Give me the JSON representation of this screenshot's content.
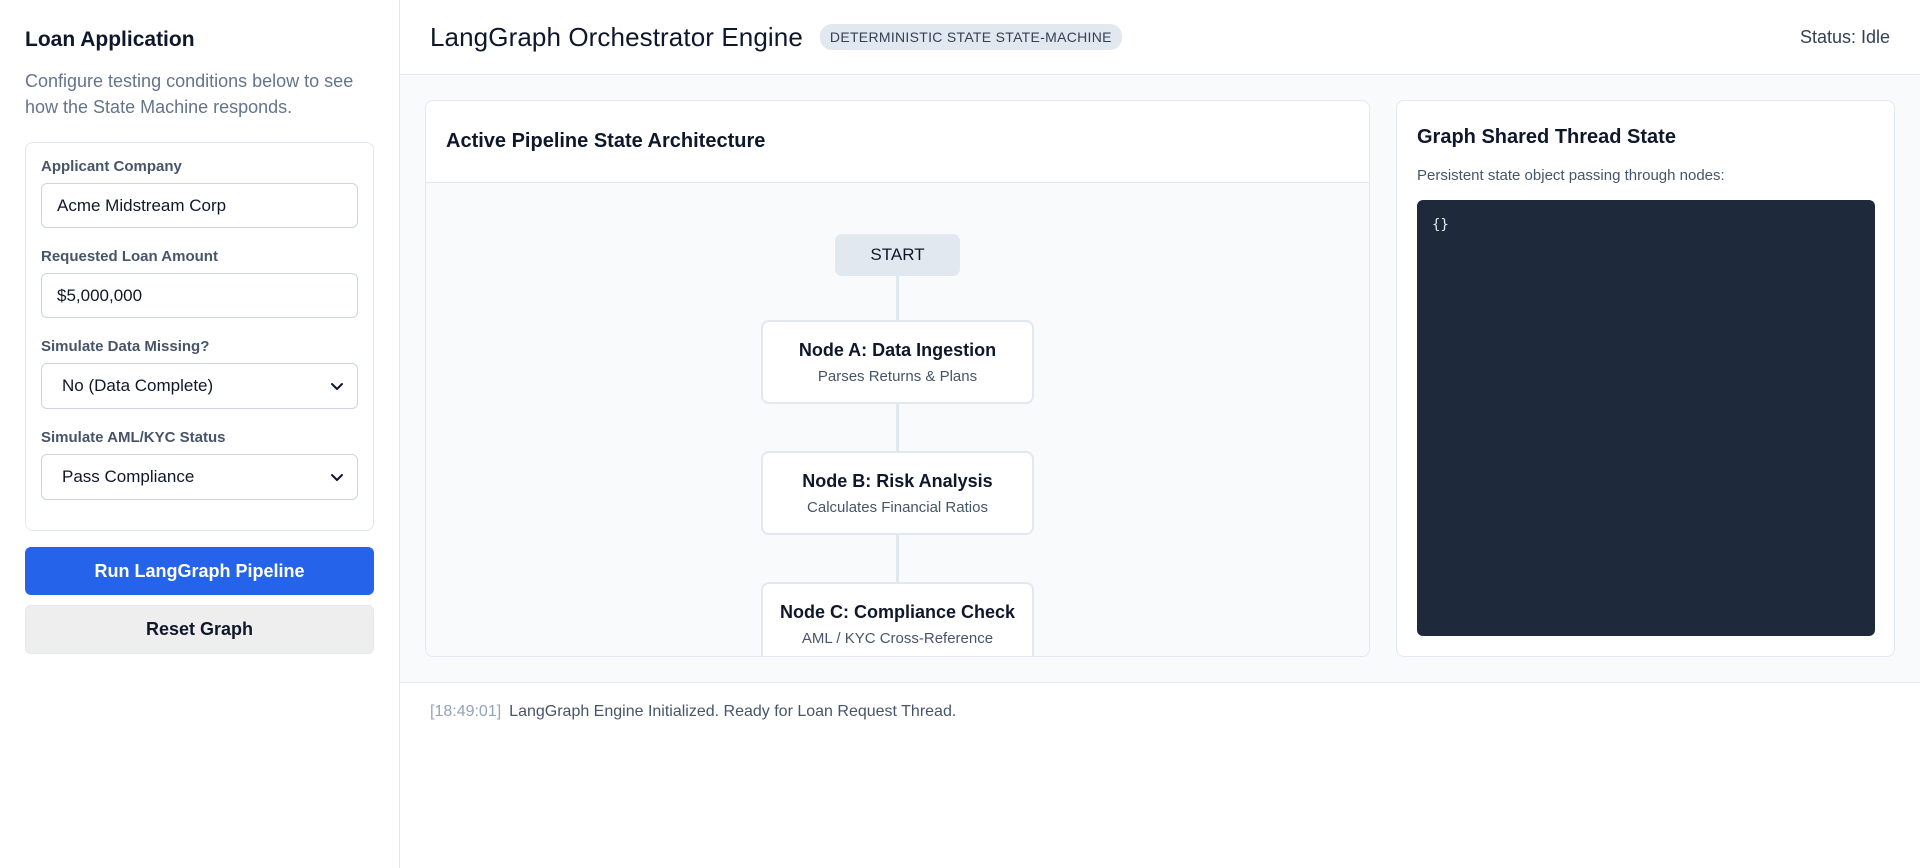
{
  "sidebar": {
    "title": "Loan Application",
    "intro": "Configure testing conditions below to see how the State Machine responds.",
    "fields": {
      "company": {
        "label": "Applicant Company",
        "value": "Acme Midstream Corp"
      },
      "amount": {
        "label": "Requested Loan Amount",
        "value": "$5,000,000"
      },
      "missing": {
        "label": "Simulate Data Missing?",
        "selected": "No (Data Complete)"
      },
      "aml": {
        "label": "Simulate AML/KYC Status",
        "selected": "Pass Compliance"
      }
    },
    "run_label": "Run LangGraph Pipeline",
    "reset_label": "Reset Graph"
  },
  "header": {
    "title": "LangGraph Orchestrator Engine",
    "badge": "DETERMINISTIC STATE STATE-MACHINE",
    "status": "Status: Idle"
  },
  "pipeline": {
    "title": "Active Pipeline State Architecture",
    "start_label": "START",
    "nodes": [
      {
        "title": "Node A: Data Ingestion",
        "subtitle": "Parses Returns & Plans"
      },
      {
        "title": "Node B: Risk Analysis",
        "subtitle": "Calculates Financial Ratios"
      },
      {
        "title": "Node C: Compliance Check",
        "subtitle": "AML / KYC Cross-Reference"
      }
    ]
  },
  "state_panel": {
    "title": "Graph Shared Thread State",
    "description": "Persistent state object passing through nodes:",
    "json_text": "{}"
  },
  "log": {
    "entries": [
      {
        "time": "[18:49:01]",
        "message": "LangGraph Engine Initialized. Ready for Loan Request Thread."
      }
    ]
  },
  "colors": {
    "accent": "#2563eb",
    "code_bg": "#1e293b"
  }
}
